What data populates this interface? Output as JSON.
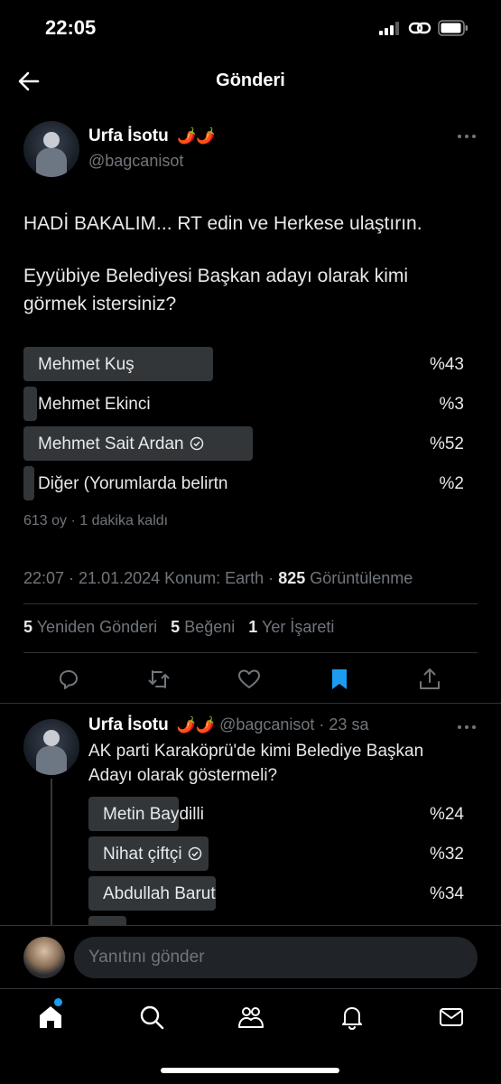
{
  "status_bar": {
    "time": "22:05"
  },
  "header": {
    "title": "Gönderi"
  },
  "post": {
    "author_name": "Urfa İsotu",
    "author_emoji": "🌶️🌶️",
    "handle": "@bagcanisot",
    "text_line1": "HADİ BAKALIM... RT edin ve Herkese ulaştırın.",
    "text_line2": "Eyyübiye Belediyesi Başkan adayı olarak kimi görmek istersiniz?",
    "poll": [
      {
        "label": "Mehmet Kuş",
        "percent": "%43",
        "value": 43,
        "chosen": false
      },
      {
        "label": "Mehmet Ekinci",
        "percent": "%3",
        "value": 3,
        "chosen": false
      },
      {
        "label": "Mehmet Sait Ardan",
        "percent": "%52",
        "value": 52,
        "chosen": true
      },
      {
        "label": "Diğer (Yorumlarda belirtn",
        "percent": "%2",
        "value": 2,
        "chosen": false
      }
    ],
    "poll_meta": "613 oy · 1 dakika kaldı",
    "timestamp": "22:07 · 21.01.2024 Konum: Earth · ",
    "views_count": "825",
    "views_label": "Görüntülenme",
    "reposts_count": "5",
    "reposts_label": "Yeniden Gönderi",
    "likes_count": "5",
    "likes_label": "Beğeni",
    "bookmarks_count": "1",
    "bookmarks_label": "Yer İşareti"
  },
  "reply": {
    "author_name": "Urfa İsotu",
    "author_emoji": "🌶️🌶️",
    "handle": "@bagcanisot",
    "time": "· 23 sa",
    "text": "AK parti Karaköprü'de kimi Belediye Başkan Adayı olarak göstermeli?",
    "poll": [
      {
        "label": "Metin Baydilli",
        "percent": "%24",
        "value": 24,
        "chosen": false
      },
      {
        "label": "Nihat çiftçi",
        "percent": "%32",
        "value": 32,
        "chosen": true
      },
      {
        "label": "Abdullah Barut",
        "percent": "%34",
        "value": 34,
        "chosen": false
      }
    ]
  },
  "reply_bar": {
    "placeholder": "Yanıtını gönder"
  },
  "colors": {
    "accent": "#1d9bf0",
    "poll_fill": "#333639",
    "muted": "#71767b"
  }
}
